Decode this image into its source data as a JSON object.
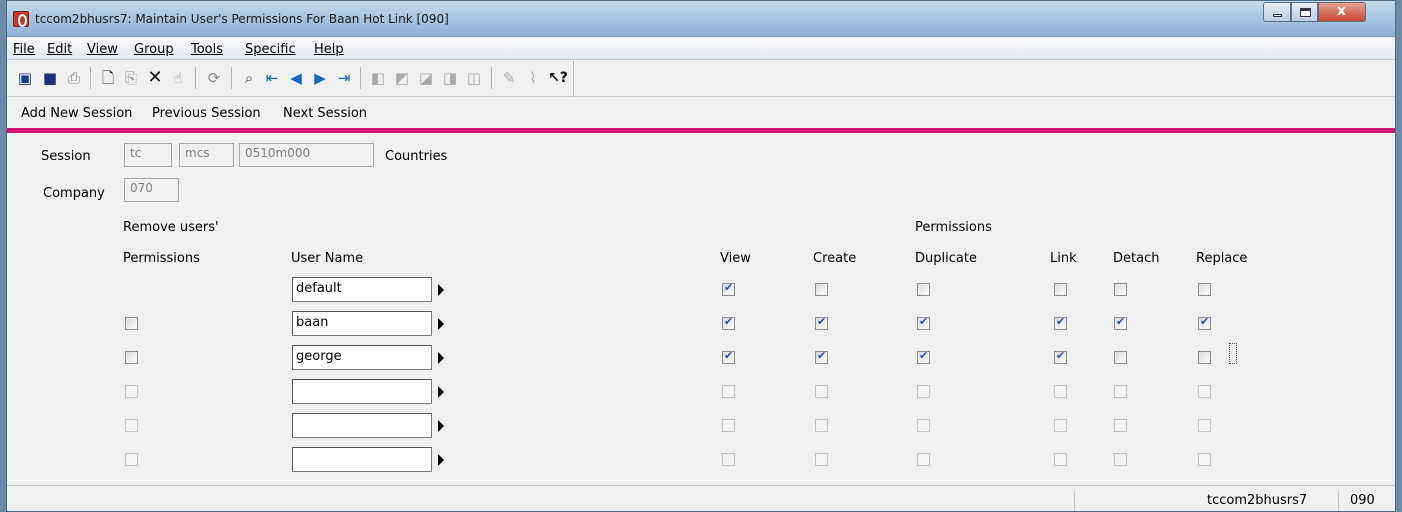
{
  "window": {
    "title": "tccom2bhusrs7: Maintain User's Permissions For Baan Hot Link [090]"
  },
  "menu": [
    "File",
    "Edit",
    "View",
    "Group",
    "Tools",
    "Specific",
    "Help"
  ],
  "toolbar_icons": [
    "open-icon",
    "save-icon",
    "print-icon",
    "new-icon",
    "copy-icon",
    "delete-icon",
    "mark-icon",
    "refresh-icon",
    "find-icon",
    "first-record-icon",
    "previous-record-icon",
    "next-record-icon",
    "last-record-icon",
    "first-group-icon",
    "previous-group-icon",
    "next-group-icon",
    "last-group-icon",
    "text-icon",
    "attachment-icon",
    "help-icon"
  ],
  "session_bar": {
    "add": "Add New Session",
    "previous": "Previous Session",
    "next": "Next Session"
  },
  "form": {
    "session_label": "Session",
    "session_package": "tc",
    "session_module": "mcs",
    "session_code": "0510m000",
    "session_description": "Countries",
    "company_label": "Company",
    "company_value": "070",
    "remove_users_label": "Remove users'",
    "permissions_group_label": "Permissions",
    "headers": {
      "permissions": "Permissions",
      "user_name": "User Name",
      "view": "View",
      "create": "Create",
      "duplicate": "Duplicate",
      "link": "Link",
      "detach": "Detach",
      "replace": "Replace"
    },
    "rows": [
      {
        "user": "default",
        "remove": null,
        "view": true,
        "create": false,
        "duplicate": false,
        "link": false,
        "detach": false,
        "replace": false
      },
      {
        "user": "baan",
        "remove": false,
        "view": true,
        "create": true,
        "duplicate": true,
        "link": true,
        "detach": true,
        "replace": true
      },
      {
        "user": "george",
        "remove": false,
        "view": true,
        "create": true,
        "duplicate": true,
        "link": true,
        "detach": false,
        "replace": false
      },
      {
        "user": "",
        "remove": false,
        "view": false,
        "create": false,
        "duplicate": false,
        "link": false,
        "detach": false,
        "replace": false
      },
      {
        "user": "",
        "remove": false,
        "view": false,
        "create": false,
        "duplicate": false,
        "link": false,
        "detach": false,
        "replace": false
      },
      {
        "user": "",
        "remove": false,
        "view": false,
        "create": false,
        "duplicate": false,
        "link": false,
        "detach": false,
        "replace": false
      }
    ]
  },
  "status": {
    "session": "tccom2bhusrs7",
    "company": "090"
  }
}
